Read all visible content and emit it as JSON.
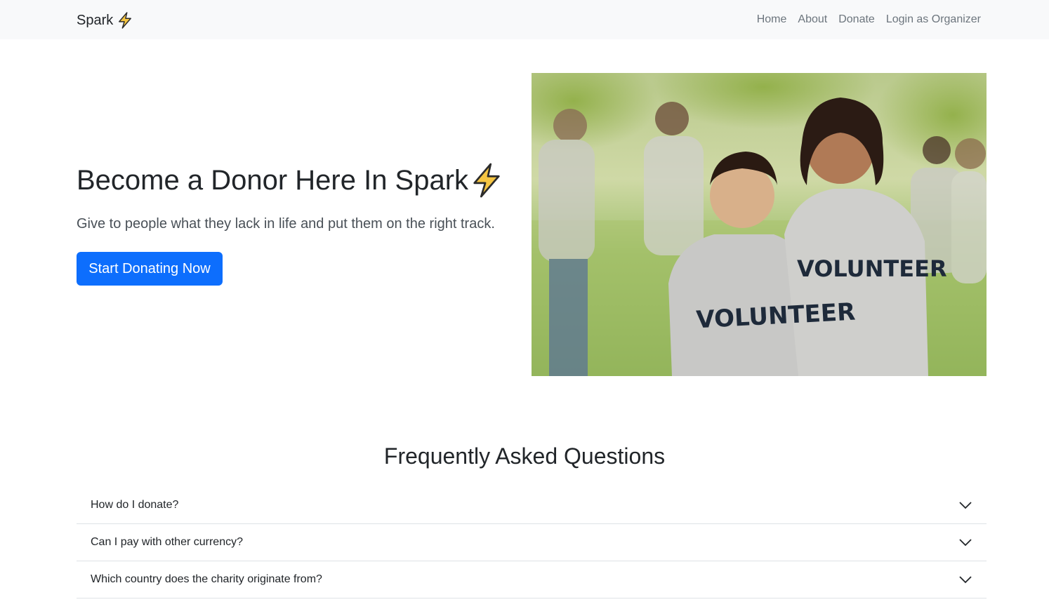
{
  "navbar": {
    "brand": "Spark",
    "links": [
      "Home",
      "About",
      "Donate",
      "Login as Organizer"
    ]
  },
  "hero": {
    "title": "Become a Donor Here In Spark",
    "subtitle": "Give to people what they lack in life and put them on the right track.",
    "cta_label": "Start Donating Now",
    "image_text": "VOLUNTEER"
  },
  "faq": {
    "title": "Frequently Asked Questions",
    "items": [
      "How do I donate?",
      "Can I pay with other currency?",
      "Which country does the charity originate from?"
    ]
  },
  "colors": {
    "primary": "#0d6efd",
    "navbar_bg": "#f8f9fa",
    "bolt": "#f5c542"
  },
  "icons": [
    "lightning-bolt-icon",
    "chevron-down-icon"
  ]
}
